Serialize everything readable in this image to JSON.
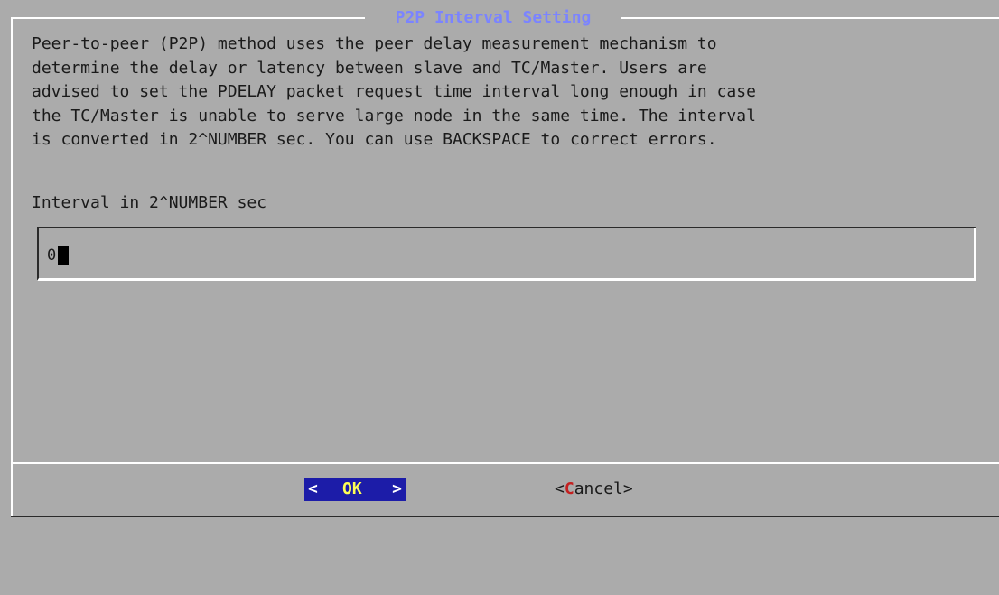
{
  "dialog": {
    "title": "P2P Interval Setting",
    "description": "Peer-to-peer (P2P) method uses the peer delay measurement mechanism to\ndetermine the delay or latency between slave and TC/Master. Users are\nadvised to set the PDELAY packet request time interval long enough in case\nthe TC/Master is unable to serve large node in the same time. The interval\nis converted in 2^NUMBER sec. You can use BACKSPACE to correct errors.",
    "field_label": "Interval in 2^NUMBER sec",
    "input_value": "0"
  },
  "buttons": {
    "ok": {
      "left_bracket": "<",
      "label": "OK",
      "right_bracket": ">"
    },
    "cancel": {
      "open": "<",
      "hotkey": "C",
      "rest": "ancel",
      "close": ">"
    }
  },
  "colors": {
    "background": "#ababab",
    "title": "#7b84ff",
    "ok_background": "#1c1ca8",
    "ok_label": "#ffff55",
    "hotkey": "#c42020"
  }
}
